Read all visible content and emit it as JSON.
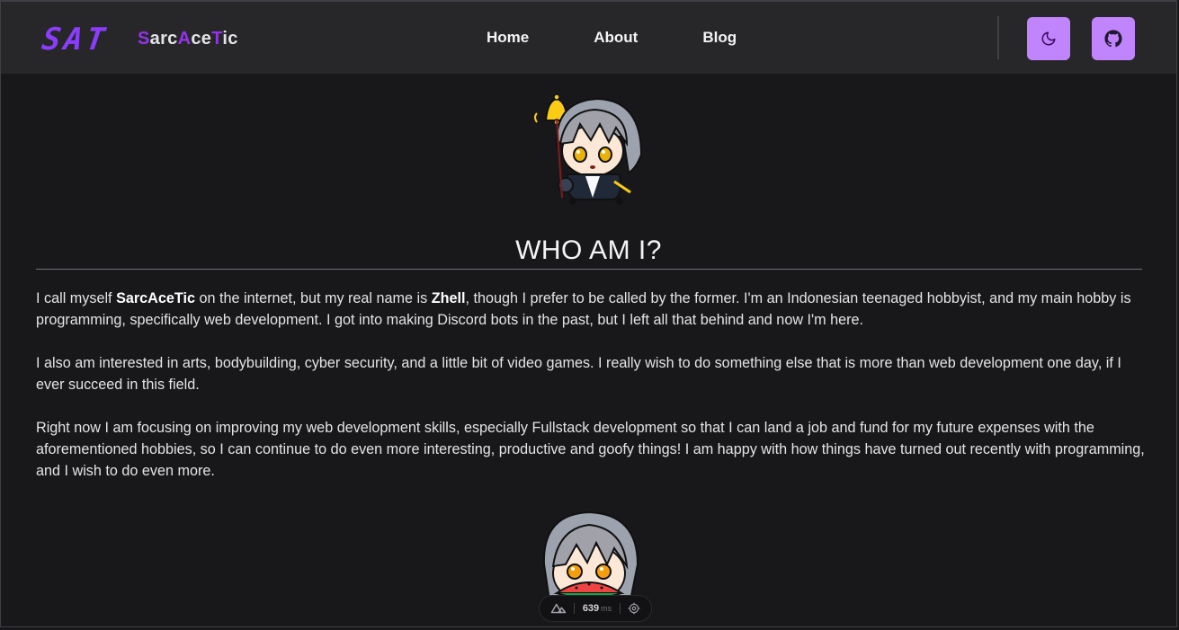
{
  "header": {
    "logo_text": "SAT",
    "brand": {
      "parts": [
        "S",
        "arc",
        "A",
        "ce",
        "T",
        "ic"
      ]
    },
    "nav": [
      {
        "label": "Home"
      },
      {
        "label": "About"
      },
      {
        "label": "Blog"
      }
    ],
    "buttons": {
      "theme_icon": "moon-icon",
      "github_icon": "github-icon"
    }
  },
  "main": {
    "title": "WHO AM I?",
    "paragraphs": {
      "p1": {
        "a": "I call myself ",
        "b": "SarcAceTic",
        "c": " on the internet, but my real name is ",
        "d": "Zhell",
        "e": ", though I prefer to be called by the former. I'm an Indonesian teenaged hobbyist, and my main hobby is programming, specifically web development. I got into making Discord bots in the past, but I left all that behind and now I'm here."
      },
      "p2": "I also am interested in arts, bodybuilding, cyber security, and a little bit of video games. I really wish to do something else that is more than web development one day, if I ever succeed in this field.",
      "p3": "Right now I am focusing on improving my web development skills, especially Fullstack development so that I can land a job and fund for my future expenses with the aforementioned hobbies, so I can continue to do even more interesting, productive and goofy things! I am happy with how things have turned out recently with programming, and I wish to do even more."
    },
    "images": {
      "top": "chibi-character-with-bell",
      "bottom": "chibi-character-eating-watermelon"
    }
  },
  "dev_overlay": {
    "time_value": "639",
    "time_unit": "ms",
    "left_icon": "nuxt-logo-icon",
    "right_icon": "inspect-target-icon"
  },
  "colors": {
    "background": "#18181b",
    "header": "#27272a",
    "accent": "#9333ea",
    "button": "#c084fc"
  }
}
